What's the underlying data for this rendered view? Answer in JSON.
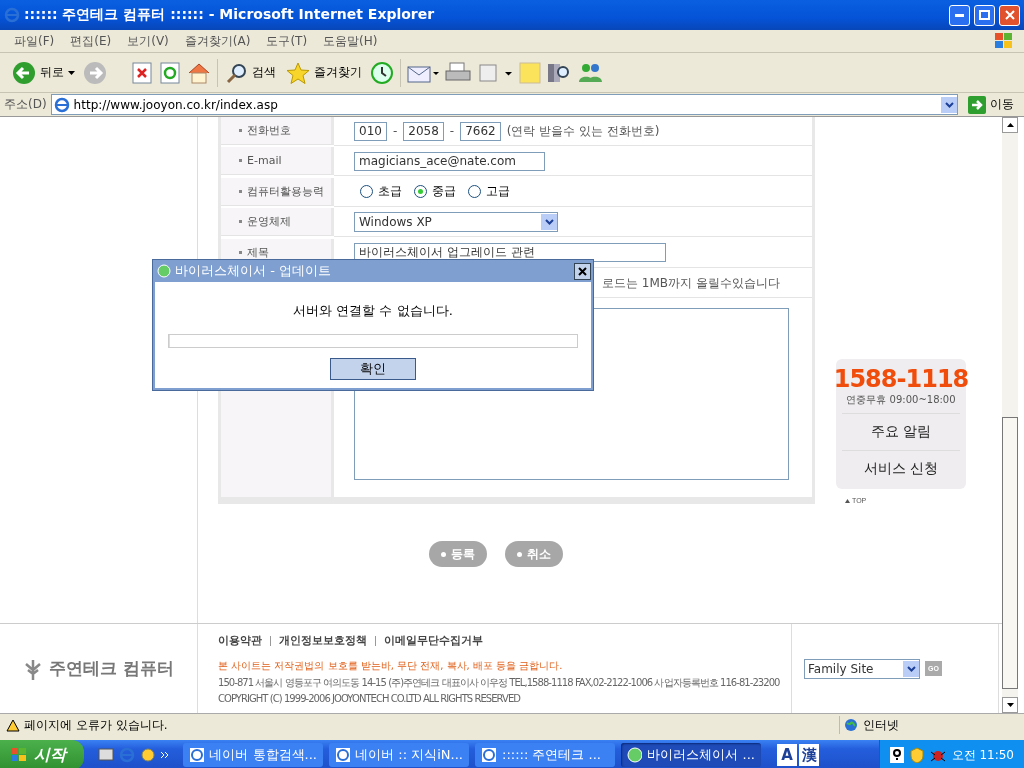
{
  "window": {
    "title": ":::::: 주연테크 컴퓨터 :::::: - Microsoft Internet Explorer"
  },
  "menu": [
    "파일(F)",
    "편집(E)",
    "보기(V)",
    "즐겨찾기(A)",
    "도구(T)",
    "도움말(H)"
  ],
  "toolbar": {
    "back": "뒤로",
    "search": "검색",
    "favorites": "즐겨찾기"
  },
  "address_bar": {
    "label": "주소(D)",
    "url": "http://www.jooyon.co.kr/index.asp",
    "go": "이동"
  },
  "form": {
    "rows": [
      {
        "kind": "phone",
        "label": "전화번호",
        "parts": [
          "010",
          "2058",
          "7662"
        ],
        "separators": [
          "-",
          "-"
        ],
        "note": "(연락 받을수 있는 전화번호)"
      },
      {
        "kind": "text",
        "label": "E-mail",
        "value": "magicians_ace@nate.com"
      },
      {
        "kind": "radio",
        "label": "컴퓨터활용능력",
        "options": [
          {
            "label": "초급",
            "selected": false
          },
          {
            "label": "중급",
            "selected": true
          },
          {
            "label": "고급",
            "selected": false
          }
        ]
      },
      {
        "kind": "select",
        "label": "운영체제",
        "value": "Windows XP"
      },
      {
        "kind": "text",
        "label": "제목",
        "value": "바이러스체이서 업그레이드 관련"
      },
      {
        "kind": "note",
        "note": "로드는 1MB까지 올릴수있습니다"
      },
      {
        "kind": "textarea"
      }
    ]
  },
  "actions": [
    "등록",
    "취소"
  ],
  "side_box": {
    "phone": "1588-1118",
    "hours": "연중무휴 09:00~18:00",
    "links": [
      "주요 알림",
      "서비스 신청"
    ],
    "top": "TOP"
  },
  "footer": {
    "logo": "주연테크 컴퓨터",
    "links": [
      "이용약관",
      "개인정보보호정책",
      "이메일무단수집거부"
    ],
    "notice": "본 사이트는 저작권법의 보호를 받는바, 무단 전재, 복사, 배포 등을 금합니다.",
    "address": "150-871 서울시 영등포구 여의도동 14-15 (주)주연테크  대표이사 이우정 TEL,1588-1118  FAX,02-2122-1006  사업자등록번호 116-81-23200",
    "copyright": "COPYRIGHT (C) 1999-2006 JOOYONTECH CO.LTD ALL RIGHTS RESERVED",
    "family_site": "Family Site",
    "go": "GO"
  },
  "dialog": {
    "title": "바이러스체이서 - 업데이트",
    "message": "서버와 연결할 수 없습니다.",
    "progress": {
      "level": 0
    },
    "button": "확인"
  },
  "status_bar": {
    "text": "페이지에 오류가 있습니다.",
    "zone": "인터넷"
  },
  "taskbar": {
    "start": "시작",
    "tasks": [
      {
        "label": "네이버 통합검색...",
        "selected": false
      },
      {
        "label": "네이버 :: 지식iN...",
        "selected": false
      },
      {
        "label": ":::::: 주연테크 ...",
        "selected": false
      },
      {
        "label": "바이러스체이서 ...",
        "selected": true
      }
    ],
    "ime": [
      "A",
      "漢"
    ],
    "clock": "오전 11:50"
  }
}
